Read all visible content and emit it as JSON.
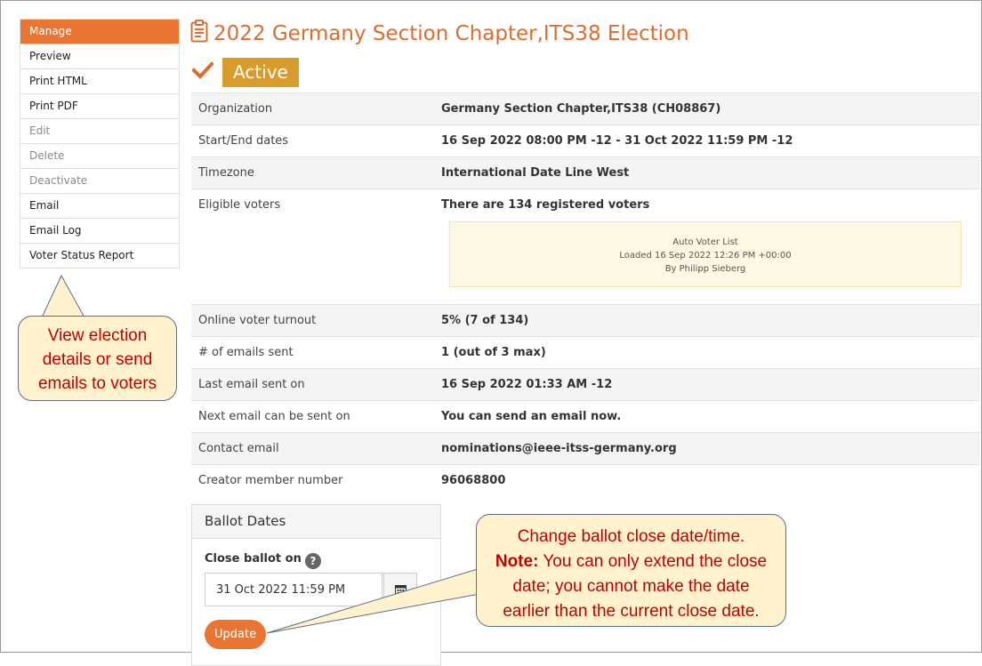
{
  "sidebar": {
    "items": [
      {
        "label": "Manage"
      },
      {
        "label": "Preview"
      },
      {
        "label": "Print HTML"
      },
      {
        "label": "Print PDF"
      },
      {
        "label": "Edit"
      },
      {
        "label": "Delete"
      },
      {
        "label": "Deactivate"
      },
      {
        "label": "Email"
      },
      {
        "label": "Email Log"
      },
      {
        "label": "Voter Status Report"
      }
    ]
  },
  "header": {
    "title": "2022 Germany Section Chapter,ITS38 Election",
    "status": "Active"
  },
  "details": {
    "organization": {
      "label": "Organization",
      "value": "Germany Section Chapter,ITS38 (CH08867)"
    },
    "dates": {
      "label": "Start/End dates",
      "value": "16 Sep 2022 08:00 PM -12 - 31 Oct 2022 11:59 PM -12"
    },
    "timezone": {
      "label": "Timezone",
      "value": "International Date Line West"
    },
    "eligible": {
      "label": "Eligible voters",
      "value": "There are 134 registered voters"
    },
    "voter_list": {
      "line1": "Auto Voter List",
      "line2": "Loaded 16 Sep 2022 12:26 PM +00:00",
      "line3": "By Philipp Sieberg"
    },
    "turnout": {
      "label": "Online voter turnout",
      "value": "5% (7 of 134)"
    },
    "emails_sent": {
      "label": "# of emails sent",
      "value": "1 (out of 3 max)"
    },
    "last_email": {
      "label": "Last email sent on",
      "value": "16 Sep 2022 01:33 AM -12"
    },
    "next_email": {
      "label": "Next email can be sent on",
      "value": "You can send an email now."
    },
    "contact": {
      "label": "Contact email",
      "value": "nominations@ieee-itss-germany.org"
    },
    "creator": {
      "label": "Creator member number",
      "value": "96068800"
    }
  },
  "ballot": {
    "heading": "Ballot Dates",
    "close_label": "Close ballot on",
    "help": "?",
    "close_value": "31 Oct 2022 11:59 PM",
    "update_label": "Update"
  },
  "callouts": {
    "left": {
      "line1": "View election",
      "line2": "details or send",
      "line3": "emails to voters"
    },
    "right": {
      "line1": "Change ballot close date/time.",
      "note_label": "Note:",
      "line2_rest": " You can only extend the close",
      "line3": "date; you cannot make the date",
      "line4": "earlier than the current close date."
    }
  },
  "colors": {
    "accent": "#ea7432",
    "title": "#e06c2b",
    "badge": "#d89b2c",
    "callout_bg": "#fff2cc",
    "callout_text": "#c00000"
  },
  "icons": {
    "title": "clipboard-icon",
    "status": "checkmark-icon",
    "date_picker": "calendar-icon",
    "help": "question-icon"
  }
}
